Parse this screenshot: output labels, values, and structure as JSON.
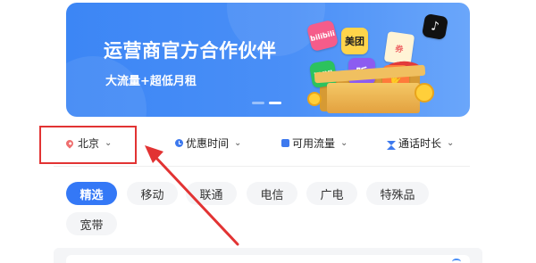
{
  "banner": {
    "title": "运营商官方合作伙伴",
    "subtitle": "大流量+超低月租",
    "apps": {
      "bilibili": "bilibili",
      "meituan": "美团",
      "ticket": "券",
      "tiktok": "♪",
      "iqiyi": "iQIYI",
      "ting": "听",
      "hand": "✋"
    },
    "carousel": {
      "count": 2,
      "active_index": 1
    }
  },
  "filters": {
    "location": {
      "label": "北京",
      "icon": "location-pin-icon"
    },
    "time": {
      "label": "优惠时间",
      "icon": "clock-icon"
    },
    "data": {
      "label": "可用流量",
      "icon": "chart-icon"
    },
    "call": {
      "label": "通话时长",
      "icon": "hourglass-icon"
    },
    "chevron": "⌄"
  },
  "categories": [
    {
      "label": "精选",
      "active": true
    },
    {
      "label": "移动",
      "active": false
    },
    {
      "label": "联通",
      "active": false
    },
    {
      "label": "电信",
      "active": false
    },
    {
      "label": "广电",
      "active": false
    },
    {
      "label": "特殊品",
      "active": false
    },
    {
      "label": "宽带",
      "active": false
    }
  ],
  "colors": {
    "accent": "#3478f6",
    "annotation": "#e23333",
    "banner": "#4a8ff7"
  }
}
